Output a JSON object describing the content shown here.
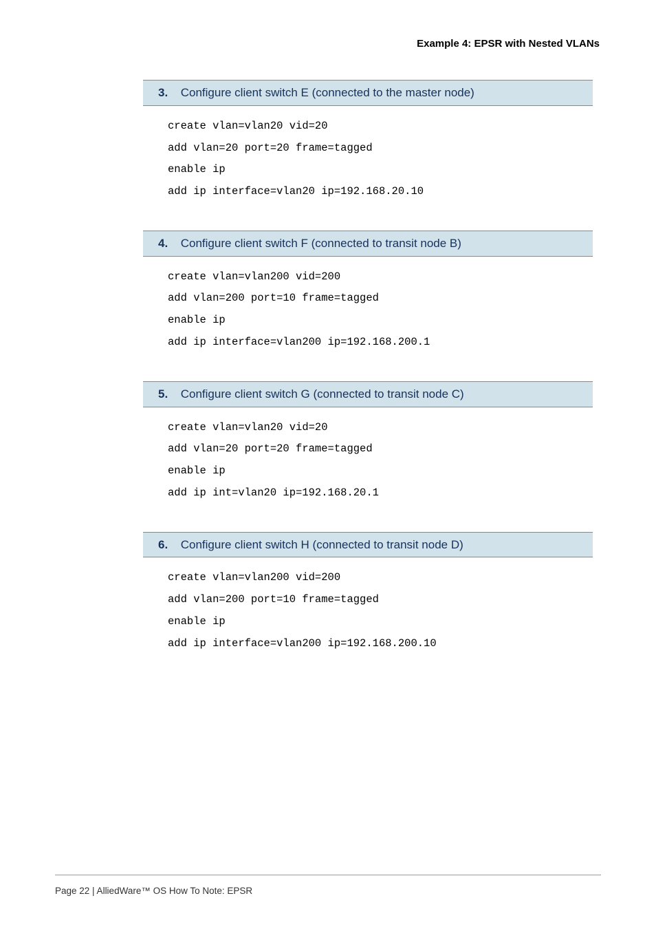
{
  "header": {
    "title": "Example 4: EPSR with Nested VLANs"
  },
  "steps": [
    {
      "num": "3.",
      "title": "Configure client switch E (connected to the master node)",
      "code": "create vlan=vlan20 vid=20\nadd vlan=20 port=20 frame=tagged\nenable ip\nadd ip interface=vlan20 ip=192.168.20.10"
    },
    {
      "num": "4.",
      "title": "Configure client switch F (connected to transit node B)",
      "code": "create vlan=vlan200 vid=200\nadd vlan=200 port=10 frame=tagged\nenable ip\nadd ip interface=vlan200 ip=192.168.200.1"
    },
    {
      "num": "5.",
      "title": "Configure client switch G (connected to transit node C)",
      "code": "create vlan=vlan20 vid=20\nadd vlan=20 port=20 frame=tagged\nenable ip\nadd ip int=vlan20 ip=192.168.20.1"
    },
    {
      "num": "6.",
      "title": "Configure client switch H (connected to transit node D)",
      "code": "create vlan=vlan200 vid=200\nadd vlan=200 port=10 frame=tagged\nenable ip\nadd ip interface=vlan200 ip=192.168.200.10"
    }
  ],
  "footer": {
    "text": "Page 22 | AlliedWare™ OS How To Note: EPSR"
  }
}
